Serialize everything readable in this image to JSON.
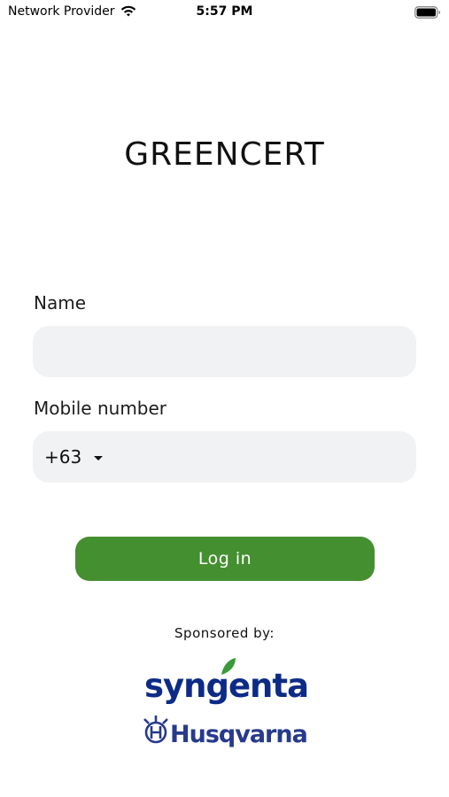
{
  "status_bar": {
    "carrier": "Network Provider",
    "time": "5:57 PM"
  },
  "app": {
    "title": "GREENCERT"
  },
  "form": {
    "name_label": "Name",
    "name_value": "",
    "mobile_label": "Mobile number",
    "country_code": "+63",
    "mobile_value": ""
  },
  "login_button": {
    "label": "Log in"
  },
  "sponsors": {
    "label": "Sponsored by:",
    "items": [
      "syngenta",
      "Husqvarna"
    ]
  },
  "colors": {
    "primary": "#448f2f",
    "input_bg": "#f1f2f4",
    "syngenta_blue": "#0d2b86",
    "syngenta_leaf": "#3a9a3a",
    "husqvarna_blue": "#273a8c"
  },
  "icons": [
    "wifi-icon",
    "battery-icon",
    "caret-down-icon",
    "syngenta-leaf-icon",
    "husqvarna-crown-icon"
  ]
}
